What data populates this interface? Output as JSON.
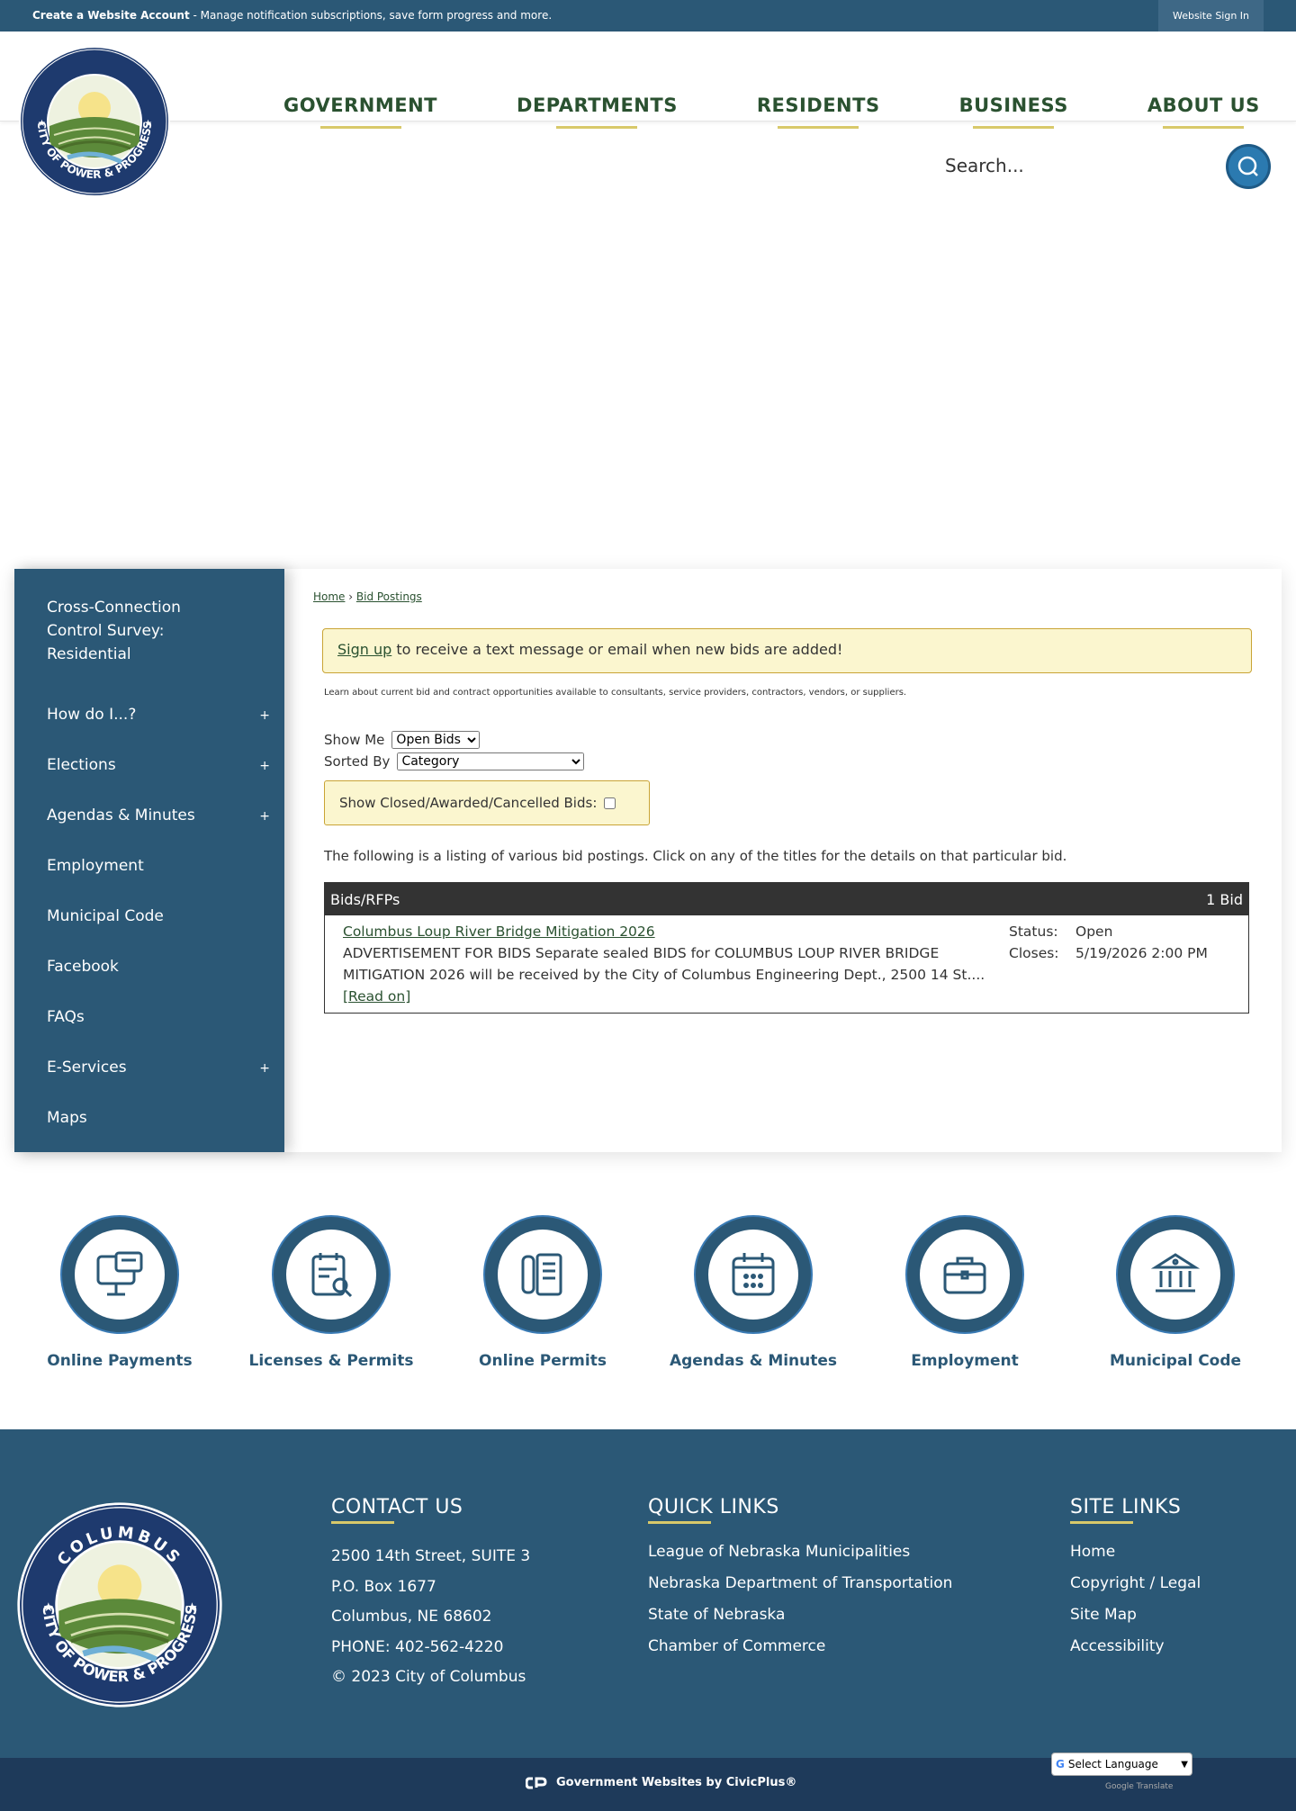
{
  "topbar": {
    "create_account": "Create a Website Account",
    "create_account_desc": " - Manage notification subscriptions, save form progress and more.",
    "sign_in": "Website Sign In"
  },
  "header": {
    "logo_text_top": "COLUMBUS",
    "logo_text_bottom": "CITY OF POWER & PROGRESS",
    "nav": [
      "GOVERNMENT",
      "DEPARTMENTS",
      "RESIDENTS",
      "BUSINESS",
      "ABOUT US"
    ],
    "search_placeholder": "Search..."
  },
  "sidebar": {
    "items": [
      {
        "label": "Cross-Connection Control Survey: Residential",
        "expand": ""
      },
      {
        "label": "How do I...?",
        "expand": "+"
      },
      {
        "label": "Elections",
        "expand": "+"
      },
      {
        "label": "Agendas & Minutes",
        "expand": "+"
      },
      {
        "label": "Employment",
        "expand": ""
      },
      {
        "label": "Municipal Code",
        "expand": ""
      },
      {
        "label": "Facebook",
        "expand": ""
      },
      {
        "label": "FAQs",
        "expand": ""
      },
      {
        "label": "E-Services",
        "expand": "+"
      },
      {
        "label": "Maps",
        "expand": ""
      }
    ]
  },
  "content": {
    "breadcrumb": {
      "home": "Home",
      "sep": " › ",
      "current": "Bid Postings"
    },
    "notice_link": "Sign up",
    "notice_text": " to receive a text message or email when new bids are added!",
    "learn": "Learn about current bid and contract opportunities available to consultants, service providers, contractors, vendors, or suppliers.",
    "show_me_label": "Show Me",
    "show_me_value": "Open Bids",
    "sorted_by_label": "Sorted By",
    "sorted_by_value": "Category",
    "closed_label": "Show Closed/Awarded/Cancelled Bids:",
    "listing_intro": "The following is a listing of various bid postings. Click on any of the titles for the details on that particular bid.",
    "table_head": "Bids/RFPs",
    "table_count": "1 Bid",
    "bid": {
      "title": "Columbus Loup River Bridge Mitigation 2026",
      "description": "ADVERTISEMENT FOR BIDS Separate sealed BIDS for COLUMBUS LOUP RIVER BRIDGE MITIGATION 2026 will be received by the City of Columbus Engineering Dept., 2500 14 St....",
      "read_on": "[Read on]",
      "status_label": "Status:",
      "status": "Open",
      "closes_label": "Closes:",
      "closes": "5/19/2026 2:00 PM"
    }
  },
  "quick_links": [
    {
      "label": "Online Payments",
      "icon": "computer-payment-icon"
    },
    {
      "label": "Licenses & Permits",
      "icon": "calendar-search-icon"
    },
    {
      "label": "Online Permits",
      "icon": "document-pen-icon"
    },
    {
      "label": "Agendas & Minutes",
      "icon": "calendar-icon"
    },
    {
      "label": "Employment",
      "icon": "briefcase-icon"
    },
    {
      "label": "Municipal Code",
      "icon": "courthouse-icon"
    }
  ],
  "footer": {
    "contact_title": "CONTACT US",
    "contact_lines": [
      "2500 14th Street, SUITE 3",
      "P.O. Box 1677",
      "Columbus, NE 68602",
      "PHONE: 402-562-4220",
      "© 2023 City of Columbus"
    ],
    "quick_title": "QUICK LINKS",
    "quick_lines": [
      "League of Nebraska Municipalities",
      "Nebraska Department of Transportation",
      "State of Nebraska",
      "Chamber of Commerce"
    ],
    "site_title": "SITE LINKS",
    "site_lines": [
      "Home",
      "Copyright / Legal",
      "Site Map",
      "Accessibility"
    ],
    "made_by": "Government Websites by CivicPlus®",
    "translate": "Select Language",
    "powered": "Google Translate"
  },
  "colors": {
    "primary": "#2b5876",
    "accent": "#d8c96a",
    "nav_text": "#2a5130",
    "notice_bg": "#fbf6cf"
  }
}
